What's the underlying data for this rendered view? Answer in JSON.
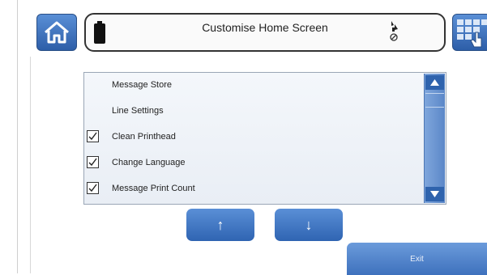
{
  "header": {
    "title": "Customise Home Screen"
  },
  "menu_list": {
    "items": [
      {
        "label": "Message Store",
        "checked": false
      },
      {
        "label": "Line Settings",
        "checked": false
      },
      {
        "label": "Clean Printhead",
        "checked": true
      },
      {
        "label": "Change Language",
        "checked": true
      },
      {
        "label": "Message Print Count",
        "checked": true
      }
    ]
  },
  "buttons": {
    "move_up": "↑",
    "move_down": "↓",
    "exit": "Exit"
  },
  "icons": {
    "home": "home-icon",
    "battery": "battery-icon",
    "status": "ink-status-icon",
    "grid": "grid-menu-icon",
    "check": "✓"
  },
  "colors": {
    "accent_blue": "#2f64b2",
    "scroll_blue": "#5b87c8",
    "panel_bg": "#eef2f8"
  }
}
